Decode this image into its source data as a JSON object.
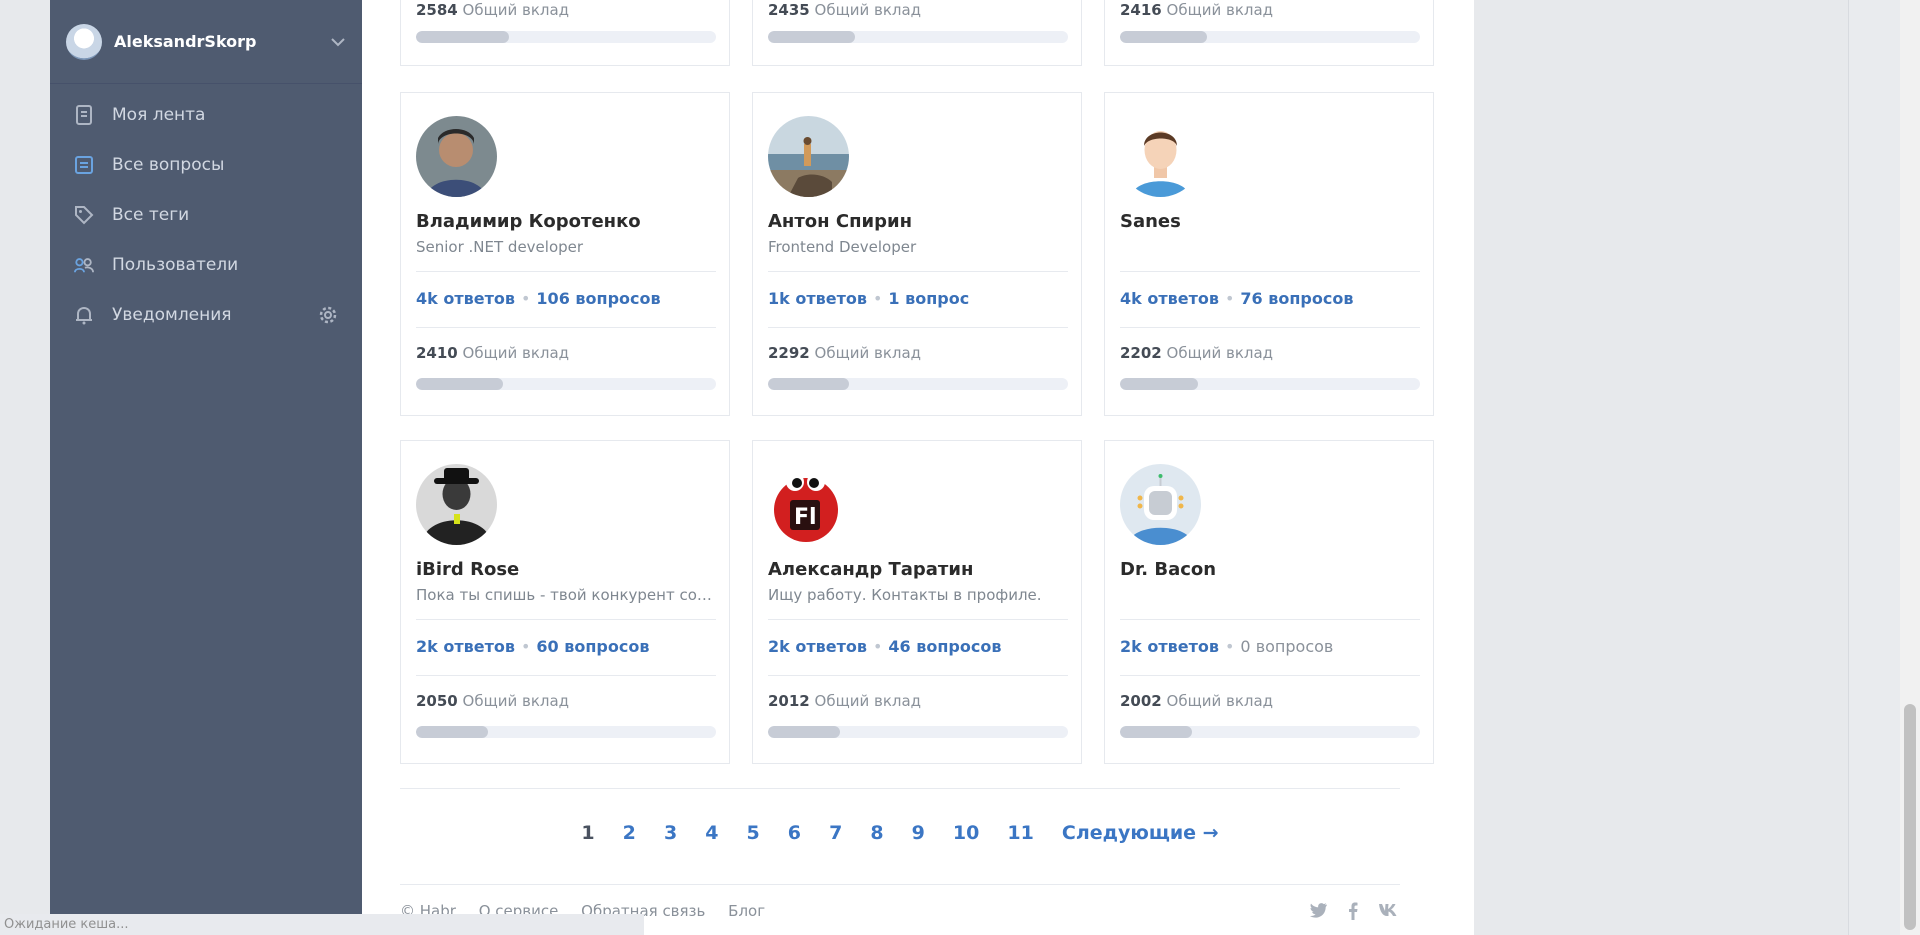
{
  "user": {
    "name": "AleksandrSkorp"
  },
  "nav": [
    {
      "label": "Моя лента"
    },
    {
      "label": "Все вопросы"
    },
    {
      "label": "Все теги"
    },
    {
      "label": "Пользователи"
    },
    {
      "label": "Уведомления"
    }
  ],
  "top_cards": [
    {
      "score": "2584",
      "contrib_label": "Общий вклад",
      "fill": 0.31
    },
    {
      "score": "2435",
      "contrib_label": "Общий вклад",
      "fill": 0.29
    },
    {
      "score": "2416",
      "contrib_label": "Общий вклад",
      "fill": 0.29
    }
  ],
  "cards": [
    {
      "name": "Владимир Коротенко",
      "about": "Senior .NET developer",
      "answers": "4k ответов",
      "questions": "106 вопросов",
      "score": "2410",
      "contrib_label": "Общий вклад",
      "fill": 0.29,
      "avatar": "photo-man"
    },
    {
      "name": "Антон Спирин",
      "about": "Frontend Developer",
      "answers": "1k ответов",
      "questions": "1 вопрос",
      "score": "2292",
      "contrib_label": "Общий вклад",
      "fill": 0.27,
      "avatar": "photo-beach"
    },
    {
      "name": "Sanes",
      "about": "",
      "answers": "4k ответов",
      "questions": "76 вопросов",
      "score": "2202",
      "contrib_label": "Общий вклад",
      "fill": 0.26,
      "avatar": "default-person"
    },
    {
      "name": "iBird Rose",
      "about": "Пока ты спишь - твой конкурент сове...",
      "answers": "2k ответов",
      "questions": "60 вопросов",
      "score": "2050",
      "contrib_label": "Общий вклад",
      "fill": 0.24,
      "avatar": "dark-figure"
    },
    {
      "name": "Александр Таратин",
      "about": "Ищу работу. Контакты в профиле.",
      "answers": "2k ответов",
      "questions": "46 вопросов",
      "score": "2012",
      "contrib_label": "Общий вклад",
      "fill": 0.24,
      "avatar": "flash-logo"
    },
    {
      "name": "Dr. Bacon",
      "about": "",
      "answers": "2k ответов",
      "questions": "0 вопросов",
      "score": "2002",
      "contrib_label": "Общий вклад",
      "fill": 0.24,
      "avatar": "robot-default",
      "questions_muted": true
    }
  ],
  "pagination": {
    "pages": [
      "1",
      "2",
      "3",
      "4",
      "5",
      "6",
      "7",
      "8",
      "9",
      "10",
      "11"
    ],
    "current": "1",
    "next": "Следующие →"
  },
  "footer": {
    "links": [
      "© Habr",
      "О сервисе",
      "Обратная связь",
      "Блог"
    ],
    "social": [
      "twitter-icon",
      "facebook-icon",
      "vk-icon"
    ]
  },
  "status_text": "Ожидание кеша...",
  "colors": {
    "sidebar": "#4f5b70",
    "link": "#3b76c4",
    "bar_fill": "#c7ccd6",
    "bar_bg": "#edf0f6"
  }
}
